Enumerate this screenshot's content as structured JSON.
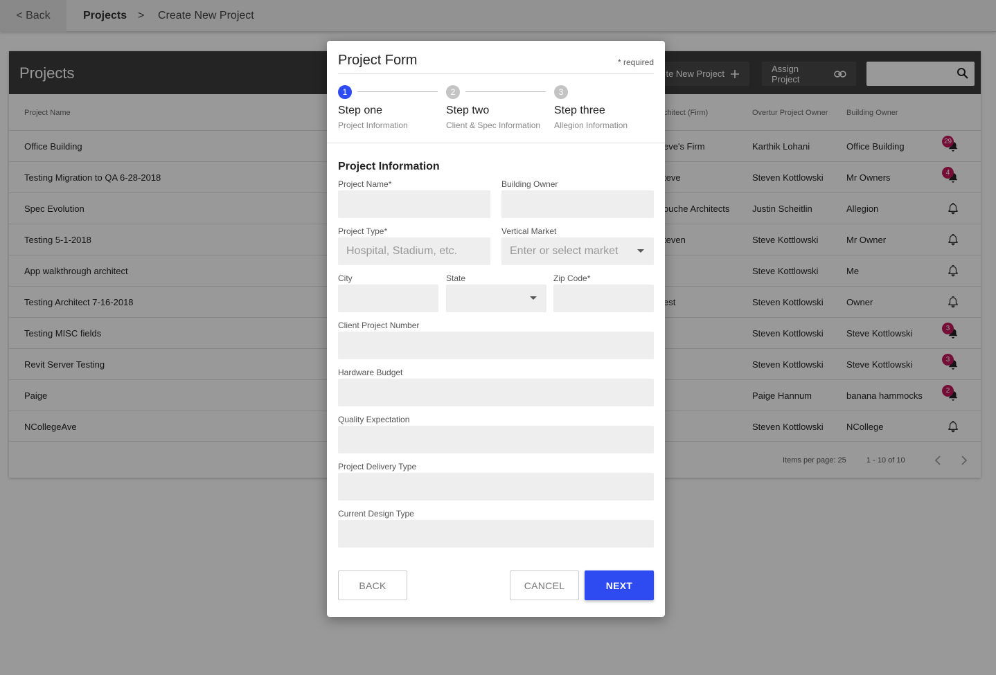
{
  "topbar": {
    "back_label": "< Back",
    "breadcrumb": {
      "projects": "Projects",
      "separator": ">",
      "current": "Create New Project"
    }
  },
  "projects_card": {
    "title": "Projects",
    "create_button": "te New Project",
    "assign_button": "Assign Project",
    "search_value": "",
    "columns": {
      "name": "Project Name",
      "firm": "chitect (Firm)",
      "owner": "Overtur Project Owner",
      "building_owner": "Building Owner"
    },
    "rows": [
      {
        "name": "Office Building",
        "firm": "eve's Firm",
        "owner": "Karthik Lohani",
        "building_owner": "Office Building",
        "notifications": "29"
      },
      {
        "name": "Testing Migration to QA 6-28-2018",
        "firm": "teve",
        "owner": "Steven Kottlowski",
        "building_owner": "Mr Owners",
        "notifications": "4"
      },
      {
        "name": "Spec Evolution",
        "firm": "ouche Architects",
        "owner": "Justin Scheitlin",
        "building_owner": "Allegion",
        "notifications": ""
      },
      {
        "name": "Testing 5-1-2018",
        "firm": "teven",
        "owner": "Steve Kottlowski",
        "building_owner": "Mr Owner",
        "notifications": ""
      },
      {
        "name": "App walkthrough architect",
        "firm": "",
        "owner": "Steve Kottlowski",
        "building_owner": "Me",
        "notifications": ""
      },
      {
        "name": "Testing Architect 7-16-2018",
        "firm": "est",
        "owner": "Steven Kottlowski",
        "building_owner": "Owner",
        "notifications": ""
      },
      {
        "name": "Testing MISC fields",
        "firm": "",
        "owner": "Steven Kottlowski",
        "building_owner": "Steve Kottlowski",
        "notifications": "3"
      },
      {
        "name": "Revit Server Testing",
        "firm": "",
        "owner": "Steven Kottlowski",
        "building_owner": "Steve Kottlowski",
        "notifications": "3"
      },
      {
        "name": "Paige",
        "firm": "",
        "owner": "Paige Hannum",
        "building_owner": "banana hammocks",
        "notifications": "2"
      },
      {
        "name": "NCollegeAve",
        "firm": "",
        "owner": "Steven Kottlowski",
        "building_owner": "NCollege",
        "notifications": ""
      }
    ],
    "footer": {
      "items_per_page": "Items per page: 25",
      "range": "1 - 10 of 10"
    }
  },
  "modal": {
    "title": "Project Form",
    "required_note": "* required",
    "steps": [
      {
        "number": "1",
        "title": "Step one",
        "subtitle": "Project Information"
      },
      {
        "number": "2",
        "title": "Step two",
        "subtitle": "Client & Spec Information"
      },
      {
        "number": "3",
        "title": "Step three",
        "subtitle": "Allegion Information"
      }
    ],
    "section_title": "Project Information",
    "fields": {
      "project_name": {
        "label": "Project Name*",
        "value": ""
      },
      "building_owner": {
        "label": "Building Owner",
        "value": ""
      },
      "project_type": {
        "label": "Project Type*",
        "placeholder": "Hospital, Stadium, etc."
      },
      "vertical_market": {
        "label": "Vertical Market",
        "placeholder": "Enter or select market"
      },
      "city": {
        "label": "City",
        "value": ""
      },
      "state": {
        "label": "State",
        "value": ""
      },
      "zip": {
        "label": "Zip Code*",
        "value": ""
      },
      "client_project_number": {
        "label": "Client Project Number",
        "value": ""
      },
      "hardware_budget": {
        "label": "Hardware Budget",
        "value": ""
      },
      "quality_expectation": {
        "label": "Quality Expectation",
        "value": ""
      },
      "delivery_type": {
        "label": "Project Delivery Type",
        "value": ""
      },
      "design_type": {
        "label": "Current Design Type",
        "value": ""
      }
    },
    "buttons": {
      "back": "BACK",
      "cancel": "CANCEL",
      "next": "NEXT"
    }
  },
  "colors": {
    "primary": "#2d4bf0",
    "header_dark": "#3d3d3d",
    "badge": "#c2185b",
    "field_bg": "#eeeeee"
  },
  "icons": {
    "search": "search-icon",
    "bell": "bell-icon",
    "add": "plus-icon",
    "link": "link-icon"
  }
}
